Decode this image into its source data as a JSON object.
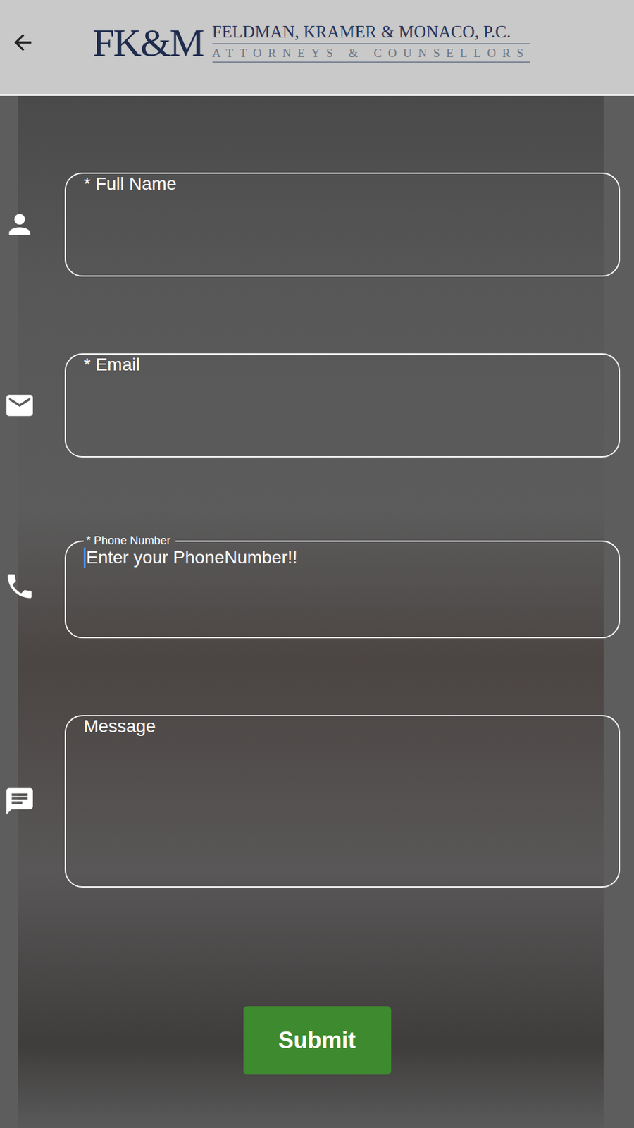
{
  "header": {
    "logo_mark": "FK&M",
    "firm_name": "FELDMAN, KRAMER & MONACO, P.C.",
    "tagline": "ATTORNEYS & COUNSELLORS"
  },
  "fields": [
    {
      "label": "* Full Name",
      "kind": "input",
      "focused": false
    },
    {
      "label": "* Email",
      "kind": "input",
      "focused": false
    },
    {
      "label": "* Phone Number",
      "placeholder": "Enter your PhoneNumber!!",
      "kind": "input",
      "focused": true
    },
    {
      "label": "Message",
      "kind": "textarea",
      "focused": false
    }
  ],
  "submit": {
    "label": "Submit"
  }
}
